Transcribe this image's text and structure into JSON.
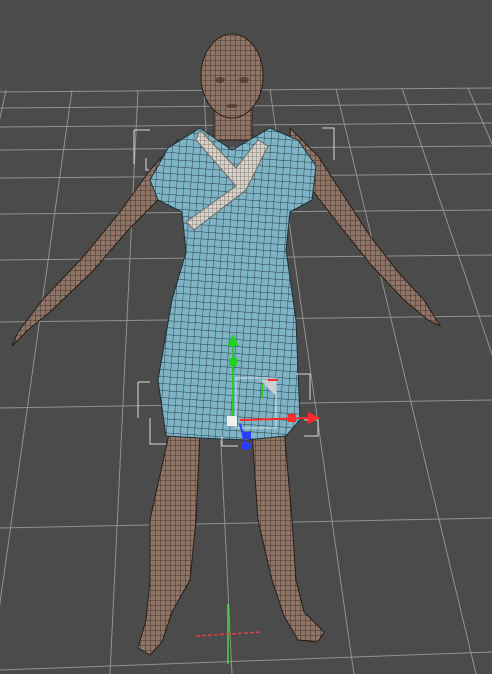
{
  "viewport": {
    "background_color": "#4b4b4b",
    "grid_color": "#9a9a9a",
    "skin_color": "#8e7566",
    "mesh_line_color": "#1e1410",
    "dress_color": "#7fb4c6",
    "dress_trim_color": "#d7d2c9",
    "bbox_bracket_color": "#e8e8e8"
  },
  "objects": {
    "figure": {
      "name": "figure",
      "wireframe": true
    },
    "dress": {
      "name": "dress",
      "wireframe": true,
      "selected": true
    }
  },
  "manipulator": {
    "axis_colors": {
      "x": "#ff2a2a",
      "y": "#21d021",
      "z": "#2a3cff"
    }
  },
  "world_axes": {
    "x_color": "#e04040",
    "y_color": "#40e040"
  }
}
